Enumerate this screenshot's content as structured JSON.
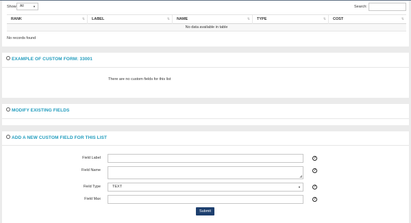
{
  "table_panel": {
    "show_label": "Show",
    "show_value": "All",
    "search_label": "Search:",
    "search_value": "",
    "columns": [
      "RANK",
      "LABEL",
      "NAME",
      "TYPE",
      "COST"
    ],
    "empty_message": "No data available in table",
    "records_message": "No records found"
  },
  "example_panel": {
    "title": "EXAMPLE OF CUSTOM FORM: 33001",
    "message": "There are no custom fields for this list"
  },
  "modify_panel": {
    "title": "MODIFY EXISTING FIELDS"
  },
  "add_panel": {
    "title": "ADD A NEW CUSTOM FIELD FOR THIS LIST",
    "fields": [
      {
        "label": "Field Label",
        "value": ""
      },
      {
        "label": "Field Name",
        "value": ""
      },
      {
        "label": "Field Type",
        "value": "TEXT"
      },
      {
        "label": "Field Max",
        "value": ""
      }
    ],
    "submit_label": "Submit"
  },
  "colors": {
    "accent": "#1f9bbd",
    "submit": "#1d3f6e"
  }
}
